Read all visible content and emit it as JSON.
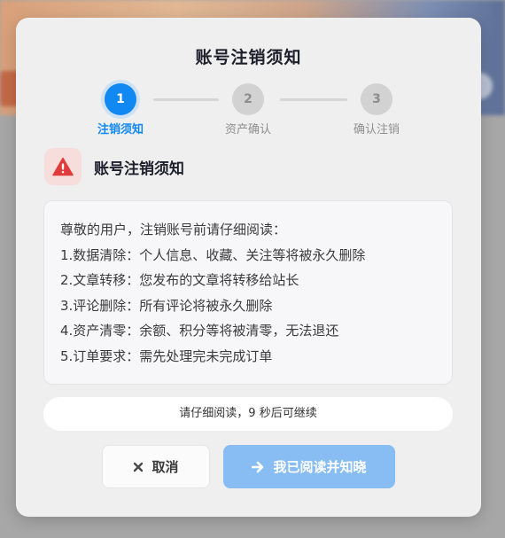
{
  "modal": {
    "title": "账号注销须知"
  },
  "stepper": {
    "steps": [
      {
        "number": "1",
        "label": "注销须知",
        "active": true
      },
      {
        "number": "2",
        "label": "资产确认",
        "active": false
      },
      {
        "number": "3",
        "label": "确认注销",
        "active": false
      }
    ]
  },
  "warning": {
    "icon": "warning-triangle-icon",
    "title": "账号注销须知"
  },
  "notice": {
    "lines": [
      "尊敬的用户，注销账号前请仔细阅读：",
      "1.数据清除：个人信息、收藏、关注等将被永久删除",
      "2.文章转移：您发布的文章将转移给站长",
      "3.评论删除：所有评论将被永久删除",
      "4.资产清零：余额、积分等将被清零，无法退还",
      "5.订单要求：需先处理完未完成订单"
    ]
  },
  "countdown": {
    "text": "请仔细阅读，9 秒后可继续"
  },
  "buttons": {
    "cancel_label": "取消",
    "cancel_icon": "close-icon",
    "confirm_label": "我已阅读并知晓",
    "confirm_icon": "arrow-right-icon"
  },
  "colors": {
    "accent": "#1289f2",
    "warning": "#e03c3c",
    "confirm_disabled": "#87bdf2"
  }
}
